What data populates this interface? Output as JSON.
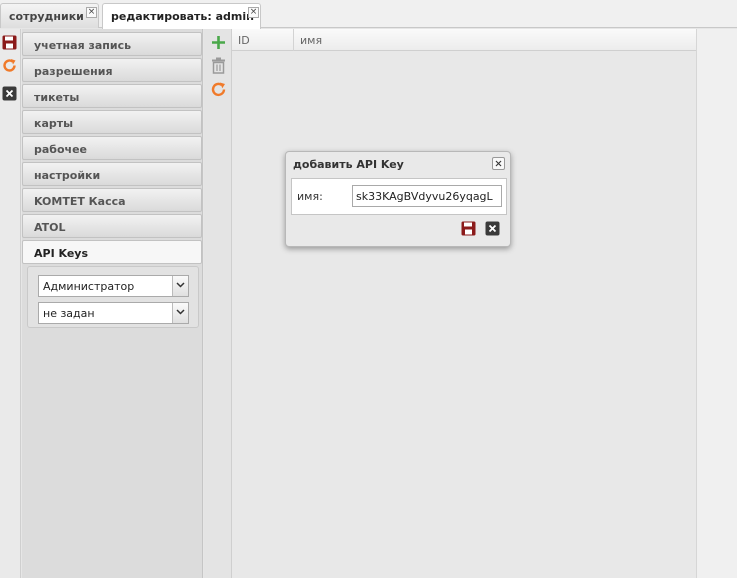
{
  "tabs": [
    {
      "label": "сотрудники",
      "close": "×"
    },
    {
      "label": "редактировать: admin",
      "close": "×"
    }
  ],
  "accordion": {
    "items": [
      {
        "label": "учетная запись"
      },
      {
        "label": "разрешения"
      },
      {
        "label": "тикеты"
      },
      {
        "label": "карты"
      },
      {
        "label": "рабочее"
      },
      {
        "label": "настройки"
      },
      {
        "label": "KOMTET Касса"
      },
      {
        "label": "ATOL"
      },
      {
        "label": "API Keys"
      }
    ],
    "open_item": "API Keys",
    "selects": [
      {
        "value": "Администратор"
      },
      {
        "value": "не задан"
      }
    ]
  },
  "grid": {
    "columns": [
      "ID",
      "имя"
    ]
  },
  "dialog": {
    "title": "добавить API Key",
    "name_label": "имя:",
    "name_value": "sk33KAgBVdyvu26yqagL"
  },
  "icons": {
    "left_toolbar": [
      "save-icon",
      "refresh-icon",
      "close-icon"
    ],
    "grid_toolbar": [
      "add-icon",
      "delete-icon",
      "refresh-icon"
    ],
    "dialog_footer": [
      "save-icon",
      "close-icon"
    ]
  },
  "colors": {
    "save": "#8b1a1a",
    "refresh": "#f07a2a",
    "add": "#4aa84a",
    "delete": "#9a9a9a",
    "close_dark": "#3a3a3a"
  }
}
